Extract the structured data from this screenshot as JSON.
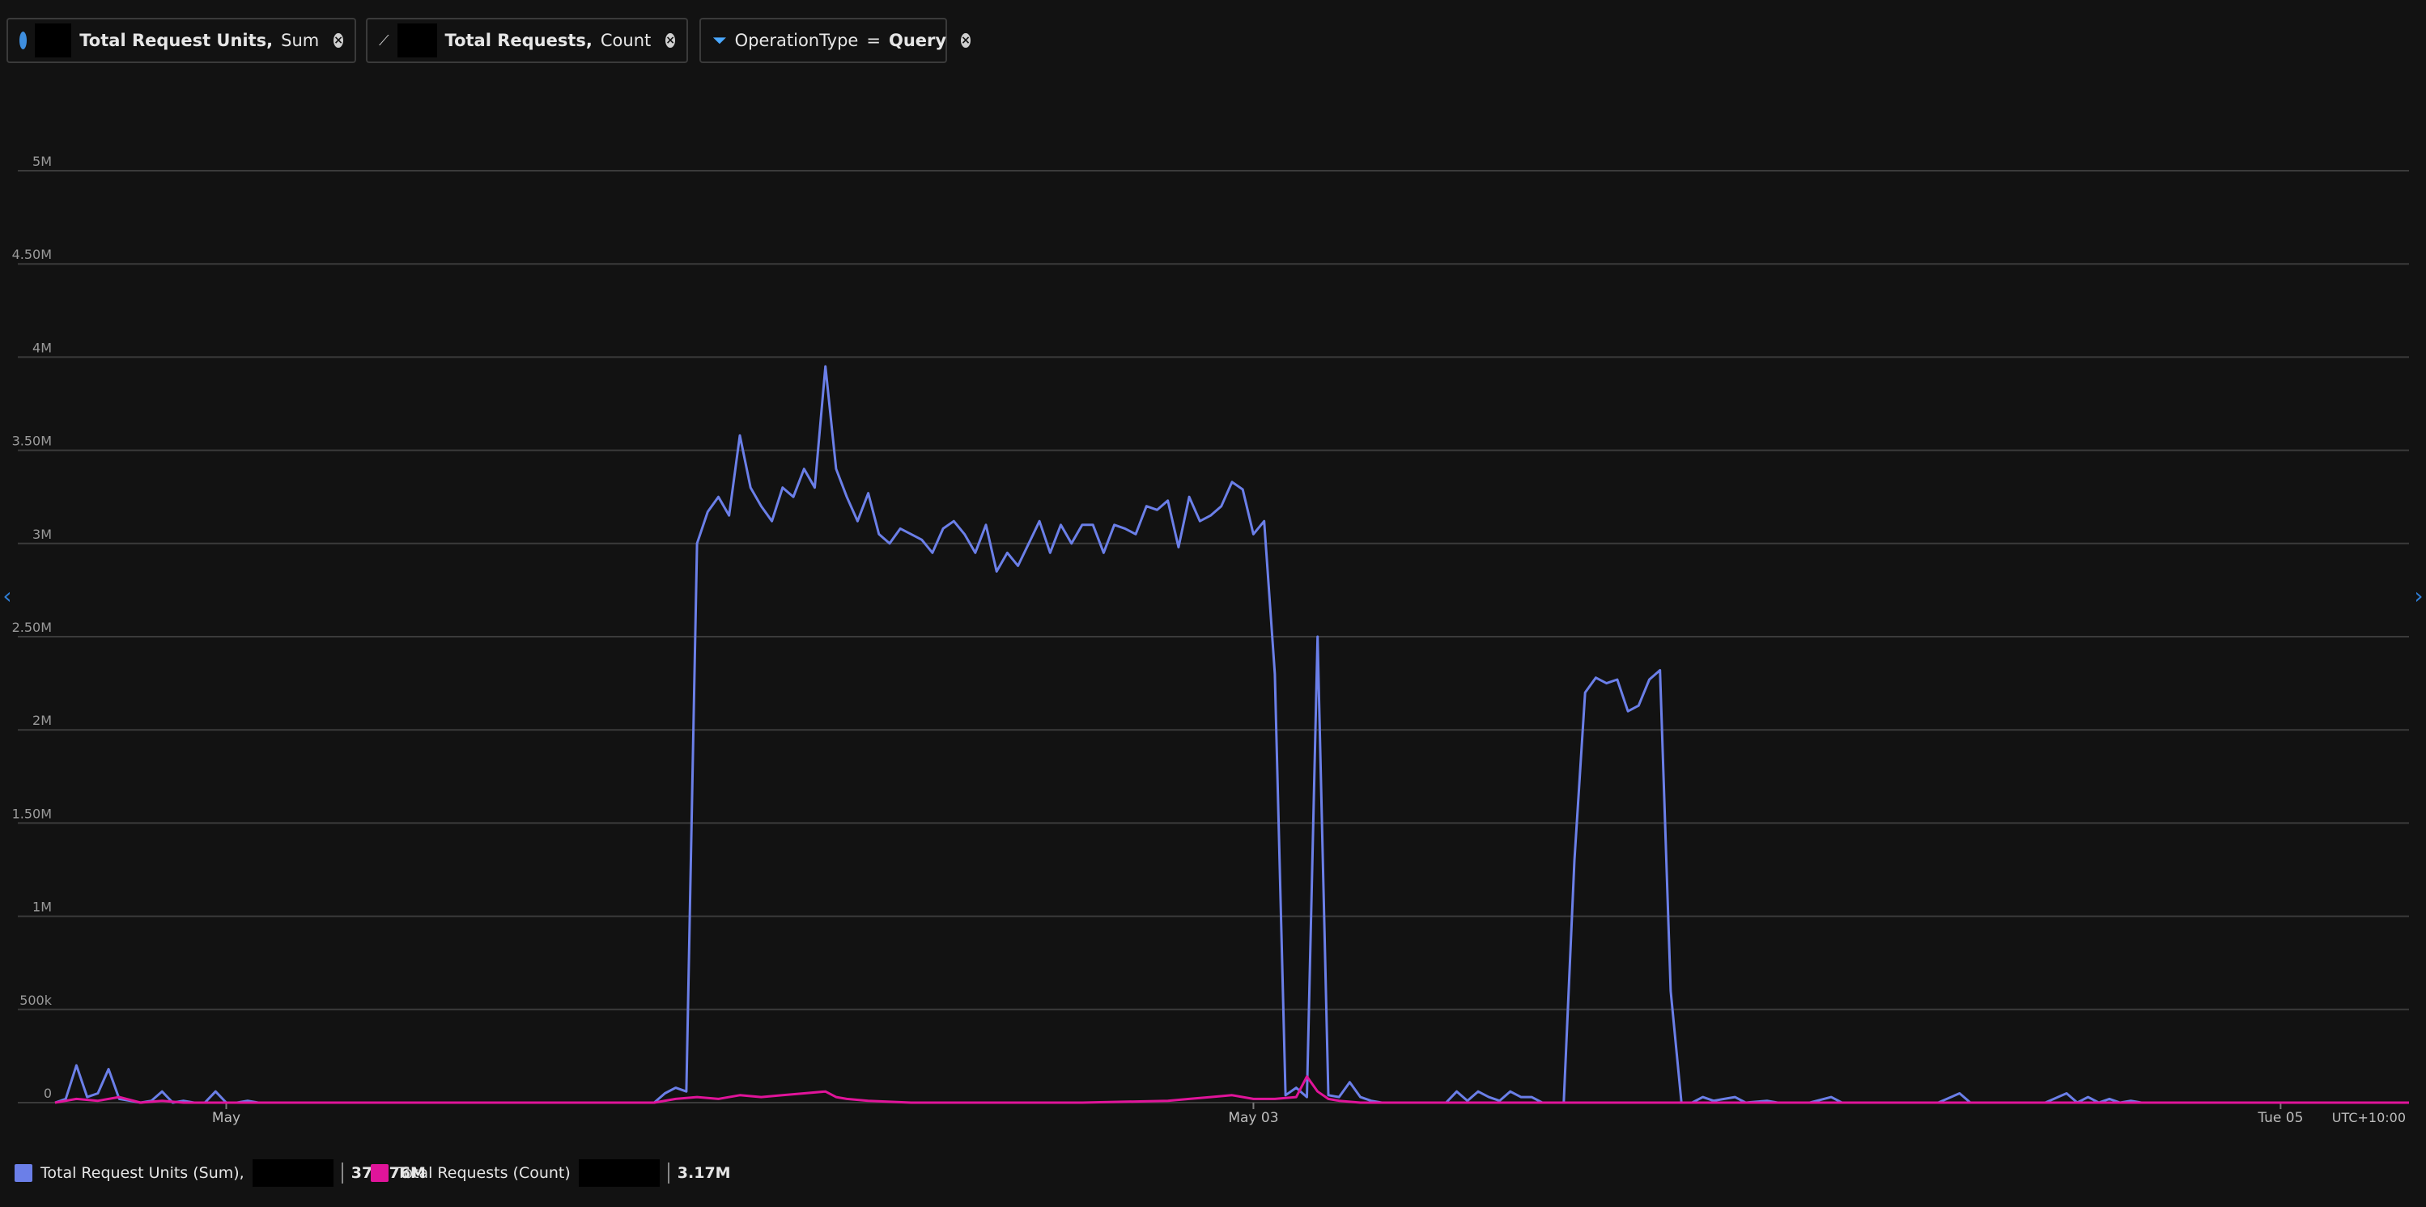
{
  "pills": [
    {
      "title": "Total Request Units,",
      "agg": "Sum",
      "icon": "cosmos-db-icon"
    },
    {
      "title": "Total Requests,",
      "agg": "Count",
      "icon": "sparkline-icon"
    },
    {
      "title": "OperationType",
      "op": "=",
      "value": "Query",
      "icon": "filter-icon"
    }
  ],
  "legend": [
    {
      "label": "Total Request Units (Sum),",
      "total": "376.76M",
      "color": "#6b7fe8"
    },
    {
      "label": "Total Requests (Count)",
      "total": "3.17M",
      "color": "#e0149a"
    }
  ],
  "timezone": "UTC+10:00",
  "chart_data": {
    "type": "line",
    "title": "",
    "ylim": [
      0,
      5000000
    ],
    "y_ticks": [
      {
        "value": 0,
        "label": "0"
      },
      {
        "value": 500000,
        "label": "500k"
      },
      {
        "value": 1000000,
        "label": "1M"
      },
      {
        "value": 1500000,
        "label": "1.50M"
      },
      {
        "value": 2000000,
        "label": "2M"
      },
      {
        "value": 2500000,
        "label": "2.50M"
      },
      {
        "value": 3000000,
        "label": "3M"
      },
      {
        "value": 3500000,
        "label": "3.50M"
      },
      {
        "value": 4000000,
        "label": "4M"
      },
      {
        "value": 4500000,
        "label": "4.50M"
      },
      {
        "value": 5000000,
        "label": "5M"
      }
    ],
    "x_range_hours": [
      -8,
      102
    ],
    "x_ticks": [
      {
        "hour": 0,
        "label": "May"
      },
      {
        "hour": 48,
        "label": "May 03"
      },
      {
        "hour": 96,
        "label": "Tue 05"
      }
    ],
    "grid": true,
    "series": [
      {
        "name": "Total Request Units (Sum)",
        "color": "#6b7fe8",
        "points": [
          [
            -8,
            0
          ],
          [
            -7.5,
            20000
          ],
          [
            -7,
            200000
          ],
          [
            -6.5,
            30000
          ],
          [
            -6,
            50000
          ],
          [
            -5.5,
            180000
          ],
          [
            -5,
            20000
          ],
          [
            -4.5,
            10000
          ],
          [
            -4,
            0
          ],
          [
            -3.5,
            10000
          ],
          [
            -3,
            60000
          ],
          [
            -2.5,
            0
          ],
          [
            -2,
            10000
          ],
          [
            -1.5,
            0
          ],
          [
            -1,
            0
          ],
          [
            -0.5,
            60000
          ],
          [
            0,
            0
          ],
          [
            0.5,
            0
          ],
          [
            1,
            10000
          ],
          [
            1.5,
            0
          ],
          [
            2,
            0
          ],
          [
            3,
            0
          ],
          [
            4,
            0
          ],
          [
            5,
            0
          ],
          [
            6,
            0
          ],
          [
            7,
            0
          ],
          [
            8,
            0
          ],
          [
            9,
            0
          ],
          [
            10,
            0
          ],
          [
            11,
            0
          ],
          [
            12,
            0
          ],
          [
            13,
            0
          ],
          [
            14,
            0
          ],
          [
            15,
            0
          ],
          [
            16,
            0
          ],
          [
            17,
            0
          ],
          [
            18,
            0
          ],
          [
            19,
            0
          ],
          [
            20,
            0
          ],
          [
            20.5,
            50000
          ],
          [
            21,
            80000
          ],
          [
            21.5,
            60000
          ],
          [
            22,
            3000000
          ],
          [
            22.5,
            3170000
          ],
          [
            23,
            3250000
          ],
          [
            23.5,
            3150000
          ],
          [
            24,
            3580000
          ],
          [
            24.5,
            3300000
          ],
          [
            25,
            3200000
          ],
          [
            25.5,
            3120000
          ],
          [
            26,
            3300000
          ],
          [
            26.5,
            3250000
          ],
          [
            27,
            3400000
          ],
          [
            27.5,
            3300000
          ],
          [
            28,
            3950000
          ],
          [
            28.5,
            3400000
          ],
          [
            29,
            3250000
          ],
          [
            29.5,
            3120000
          ],
          [
            30,
            3270000
          ],
          [
            30.5,
            3050000
          ],
          [
            31,
            3000000
          ],
          [
            31.5,
            3080000
          ],
          [
            32,
            3050000
          ],
          [
            32.5,
            3020000
          ],
          [
            33,
            2950000
          ],
          [
            33.5,
            3080000
          ],
          [
            34,
            3120000
          ],
          [
            34.5,
            3050000
          ],
          [
            35,
            2950000
          ],
          [
            35.5,
            3100000
          ],
          [
            36,
            2850000
          ],
          [
            36.5,
            2950000
          ],
          [
            37,
            2880000
          ],
          [
            37.5,
            3000000
          ],
          [
            38,
            3120000
          ],
          [
            38.5,
            2950000
          ],
          [
            39,
            3100000
          ],
          [
            39.5,
            3000000
          ],
          [
            40,
            3100000
          ],
          [
            40.5,
            3100000
          ],
          [
            41,
            2950000
          ],
          [
            41.5,
            3100000
          ],
          [
            42,
            3080000
          ],
          [
            42.5,
            3050000
          ],
          [
            43,
            3200000
          ],
          [
            43.5,
            3180000
          ],
          [
            44,
            3230000
          ],
          [
            44.5,
            2980000
          ],
          [
            45,
            3250000
          ],
          [
            45.5,
            3120000
          ],
          [
            46,
            3150000
          ],
          [
            46.5,
            3200000
          ],
          [
            47,
            3330000
          ],
          [
            47.5,
            3290000
          ],
          [
            48,
            3050000
          ],
          [
            48.5,
            3120000
          ],
          [
            49,
            2300000
          ],
          [
            49.5,
            40000
          ],
          [
            50,
            80000
          ],
          [
            50.5,
            30000
          ],
          [
            51,
            2500000
          ],
          [
            51.5,
            40000
          ],
          [
            52,
            30000
          ],
          [
            52.5,
            110000
          ],
          [
            53,
            30000
          ],
          [
            53.5,
            10000
          ],
          [
            54,
            0
          ],
          [
            55,
            0
          ],
          [
            56,
            0
          ],
          [
            57,
            0
          ],
          [
            57.5,
            60000
          ],
          [
            58,
            10000
          ],
          [
            58.5,
            60000
          ],
          [
            59,
            30000
          ],
          [
            59.5,
            10000
          ],
          [
            60,
            60000
          ],
          [
            60.5,
            30000
          ],
          [
            61,
            30000
          ],
          [
            61.5,
            0
          ],
          [
            62,
            0
          ],
          [
            62.5,
            0
          ],
          [
            63,
            1300000
          ],
          [
            63.5,
            2200000
          ],
          [
            64,
            2280000
          ],
          [
            64.5,
            2250000
          ],
          [
            65,
            2270000
          ],
          [
            65.5,
            2100000
          ],
          [
            66,
            2130000
          ],
          [
            66.5,
            2270000
          ],
          [
            67,
            2320000
          ],
          [
            67.5,
            600000
          ],
          [
            68,
            0
          ],
          [
            68.5,
            0
          ],
          [
            69,
            30000
          ],
          [
            69.5,
            10000
          ],
          [
            70,
            20000
          ],
          [
            70.5,
            30000
          ],
          [
            71,
            0
          ],
          [
            72,
            10000
          ],
          [
            72.5,
            0
          ],
          [
            73,
            0
          ],
          [
            74,
            0
          ],
          [
            75,
            30000
          ],
          [
            75.5,
            0
          ],
          [
            76,
            0
          ],
          [
            77,
            0
          ],
          [
            78,
            0
          ],
          [
            79,
            0
          ],
          [
            80,
            0
          ],
          [
            81,
            50000
          ],
          [
            81.5,
            0
          ],
          [
            82,
            0
          ],
          [
            83,
            0
          ],
          [
            84,
            0
          ],
          [
            85,
            0
          ],
          [
            86,
            50000
          ],
          [
            86.5,
            0
          ],
          [
            87,
            30000
          ],
          [
            87.5,
            0
          ],
          [
            88,
            20000
          ],
          [
            88.5,
            0
          ],
          [
            89,
            10000
          ],
          [
            89.5,
            0
          ],
          [
            90,
            0
          ],
          [
            91,
            0
          ],
          [
            92,
            0
          ],
          [
            93,
            0
          ],
          [
            94,
            0
          ],
          [
            95,
            0
          ],
          [
            96,
            0
          ],
          [
            97,
            0
          ],
          [
            98,
            0
          ],
          [
            99,
            0
          ],
          [
            100,
            0
          ],
          [
            101,
            0
          ],
          [
            102,
            0
          ]
        ]
      },
      {
        "name": "Total Requests (Count)",
        "color": "#e0149a",
        "points": [
          [
            -8,
            0
          ],
          [
            -7,
            20000
          ],
          [
            -6,
            10000
          ],
          [
            -5,
            30000
          ],
          [
            -4,
            0
          ],
          [
            -3,
            10000
          ],
          [
            -2,
            0
          ],
          [
            0,
            0
          ],
          [
            5,
            0
          ],
          [
            10,
            0
          ],
          [
            15,
            0
          ],
          [
            20,
            0
          ],
          [
            21,
            20000
          ],
          [
            22,
            30000
          ],
          [
            23,
            20000
          ],
          [
            24,
            40000
          ],
          [
            25,
            30000
          ],
          [
            26,
            40000
          ],
          [
            27,
            50000
          ],
          [
            28,
            60000
          ],
          [
            28.5,
            30000
          ],
          [
            29,
            20000
          ],
          [
            30,
            10000
          ],
          [
            32,
            0
          ],
          [
            36,
            0
          ],
          [
            40,
            0
          ],
          [
            44,
            10000
          ],
          [
            45,
            20000
          ],
          [
            46,
            30000
          ],
          [
            47,
            40000
          ],
          [
            48,
            20000
          ],
          [
            49,
            20000
          ],
          [
            50,
            30000
          ],
          [
            50.5,
            140000
          ],
          [
            51,
            60000
          ],
          [
            51.5,
            20000
          ],
          [
            52,
            10000
          ],
          [
            53,
            0
          ],
          [
            56,
            0
          ],
          [
            60,
            0
          ],
          [
            64,
            0
          ],
          [
            68,
            0
          ],
          [
            72,
            0
          ],
          [
            76,
            0
          ],
          [
            80,
            0
          ],
          [
            84,
            0
          ],
          [
            88,
            0
          ],
          [
            92,
            0
          ],
          [
            96,
            0
          ],
          [
            100,
            0
          ],
          [
            102,
            0
          ]
        ]
      }
    ]
  }
}
